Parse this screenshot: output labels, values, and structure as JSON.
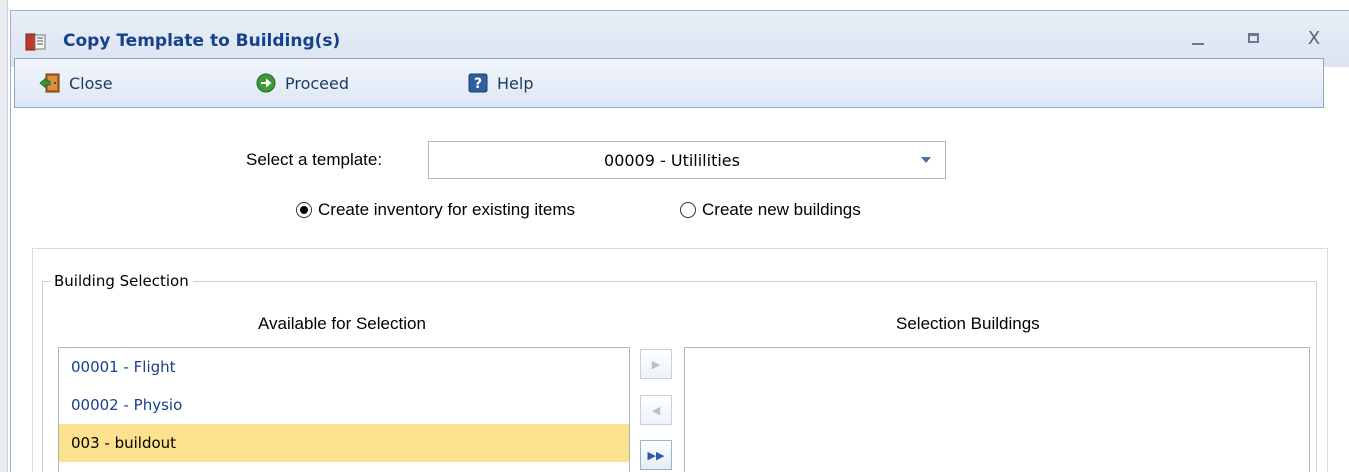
{
  "window": {
    "title": "Copy Template to Building(s)",
    "icon": "template-book-icon",
    "controls": {
      "minimize": "minimize-icon",
      "maximize": "maximize-icon",
      "close": "close-icon",
      "close_glyph": "X"
    }
  },
  "toolbar": {
    "close_label": "Close",
    "proceed_label": "Proceed",
    "help_label": "Help"
  },
  "template": {
    "label": "Select a template:",
    "selected": "00009 - Utililities"
  },
  "mode": {
    "option_existing": "Create inventory for existing items",
    "option_new": "Create new buildings",
    "selected": "existing"
  },
  "building_selection": {
    "title": "Building Selection",
    "available_header": "Available for Selection",
    "selected_header": "Selection Buildings",
    "available_items": [
      {
        "label": "00001 - Flight",
        "selected": false
      },
      {
        "label": "00002 - Physio",
        "selected": false
      },
      {
        "label": "003 - buildout",
        "selected": true
      }
    ],
    "selected_items": [],
    "move_buttons": {
      "add": "▶",
      "remove": "◀",
      "add_all": "▶▶"
    }
  },
  "colors": {
    "title_text": "#15428b",
    "highlight": "#fde18c",
    "list_text": "#15428b"
  }
}
